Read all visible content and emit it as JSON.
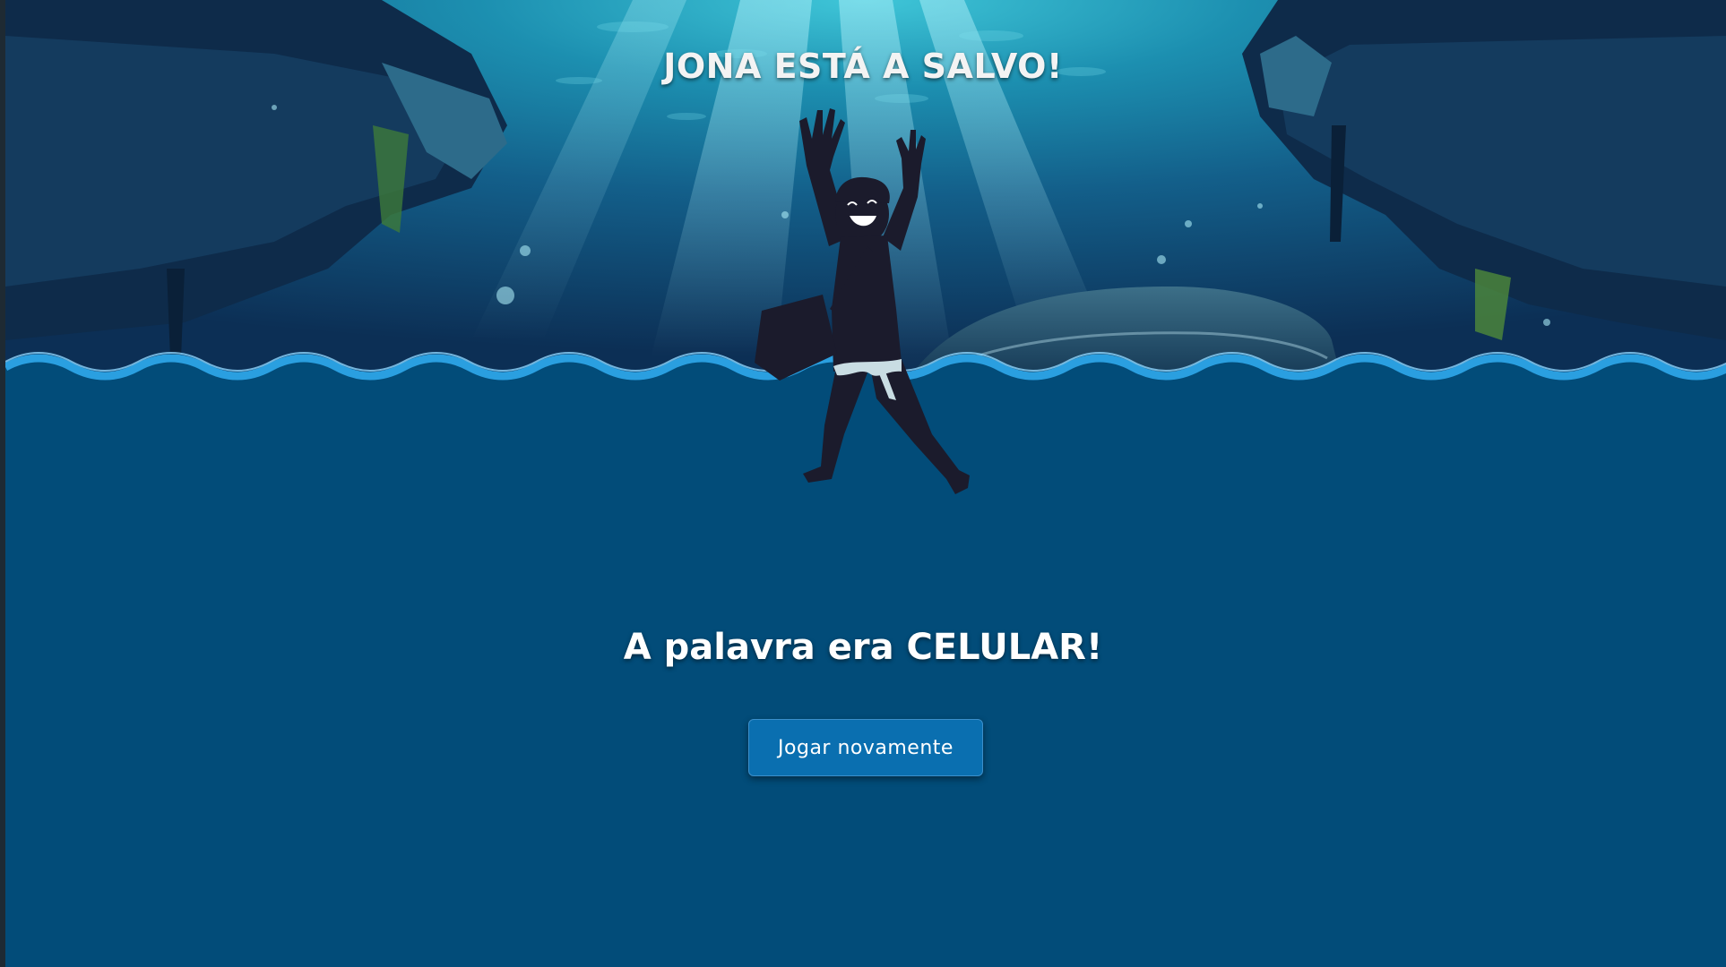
{
  "game": {
    "title": "JONA ESTÁ A SALVO!",
    "result_message": "A palavra era CELULAR!",
    "replay_button_label": "Jogar novamente"
  },
  "colors": {
    "background": "#024c79",
    "water_surface": "#2a9fe0",
    "button": "#0a6fb0",
    "text": "#ffffff"
  },
  "icons": {
    "character": "jonah-jumping-silhouette",
    "scene": "underwater-whale-scene"
  }
}
